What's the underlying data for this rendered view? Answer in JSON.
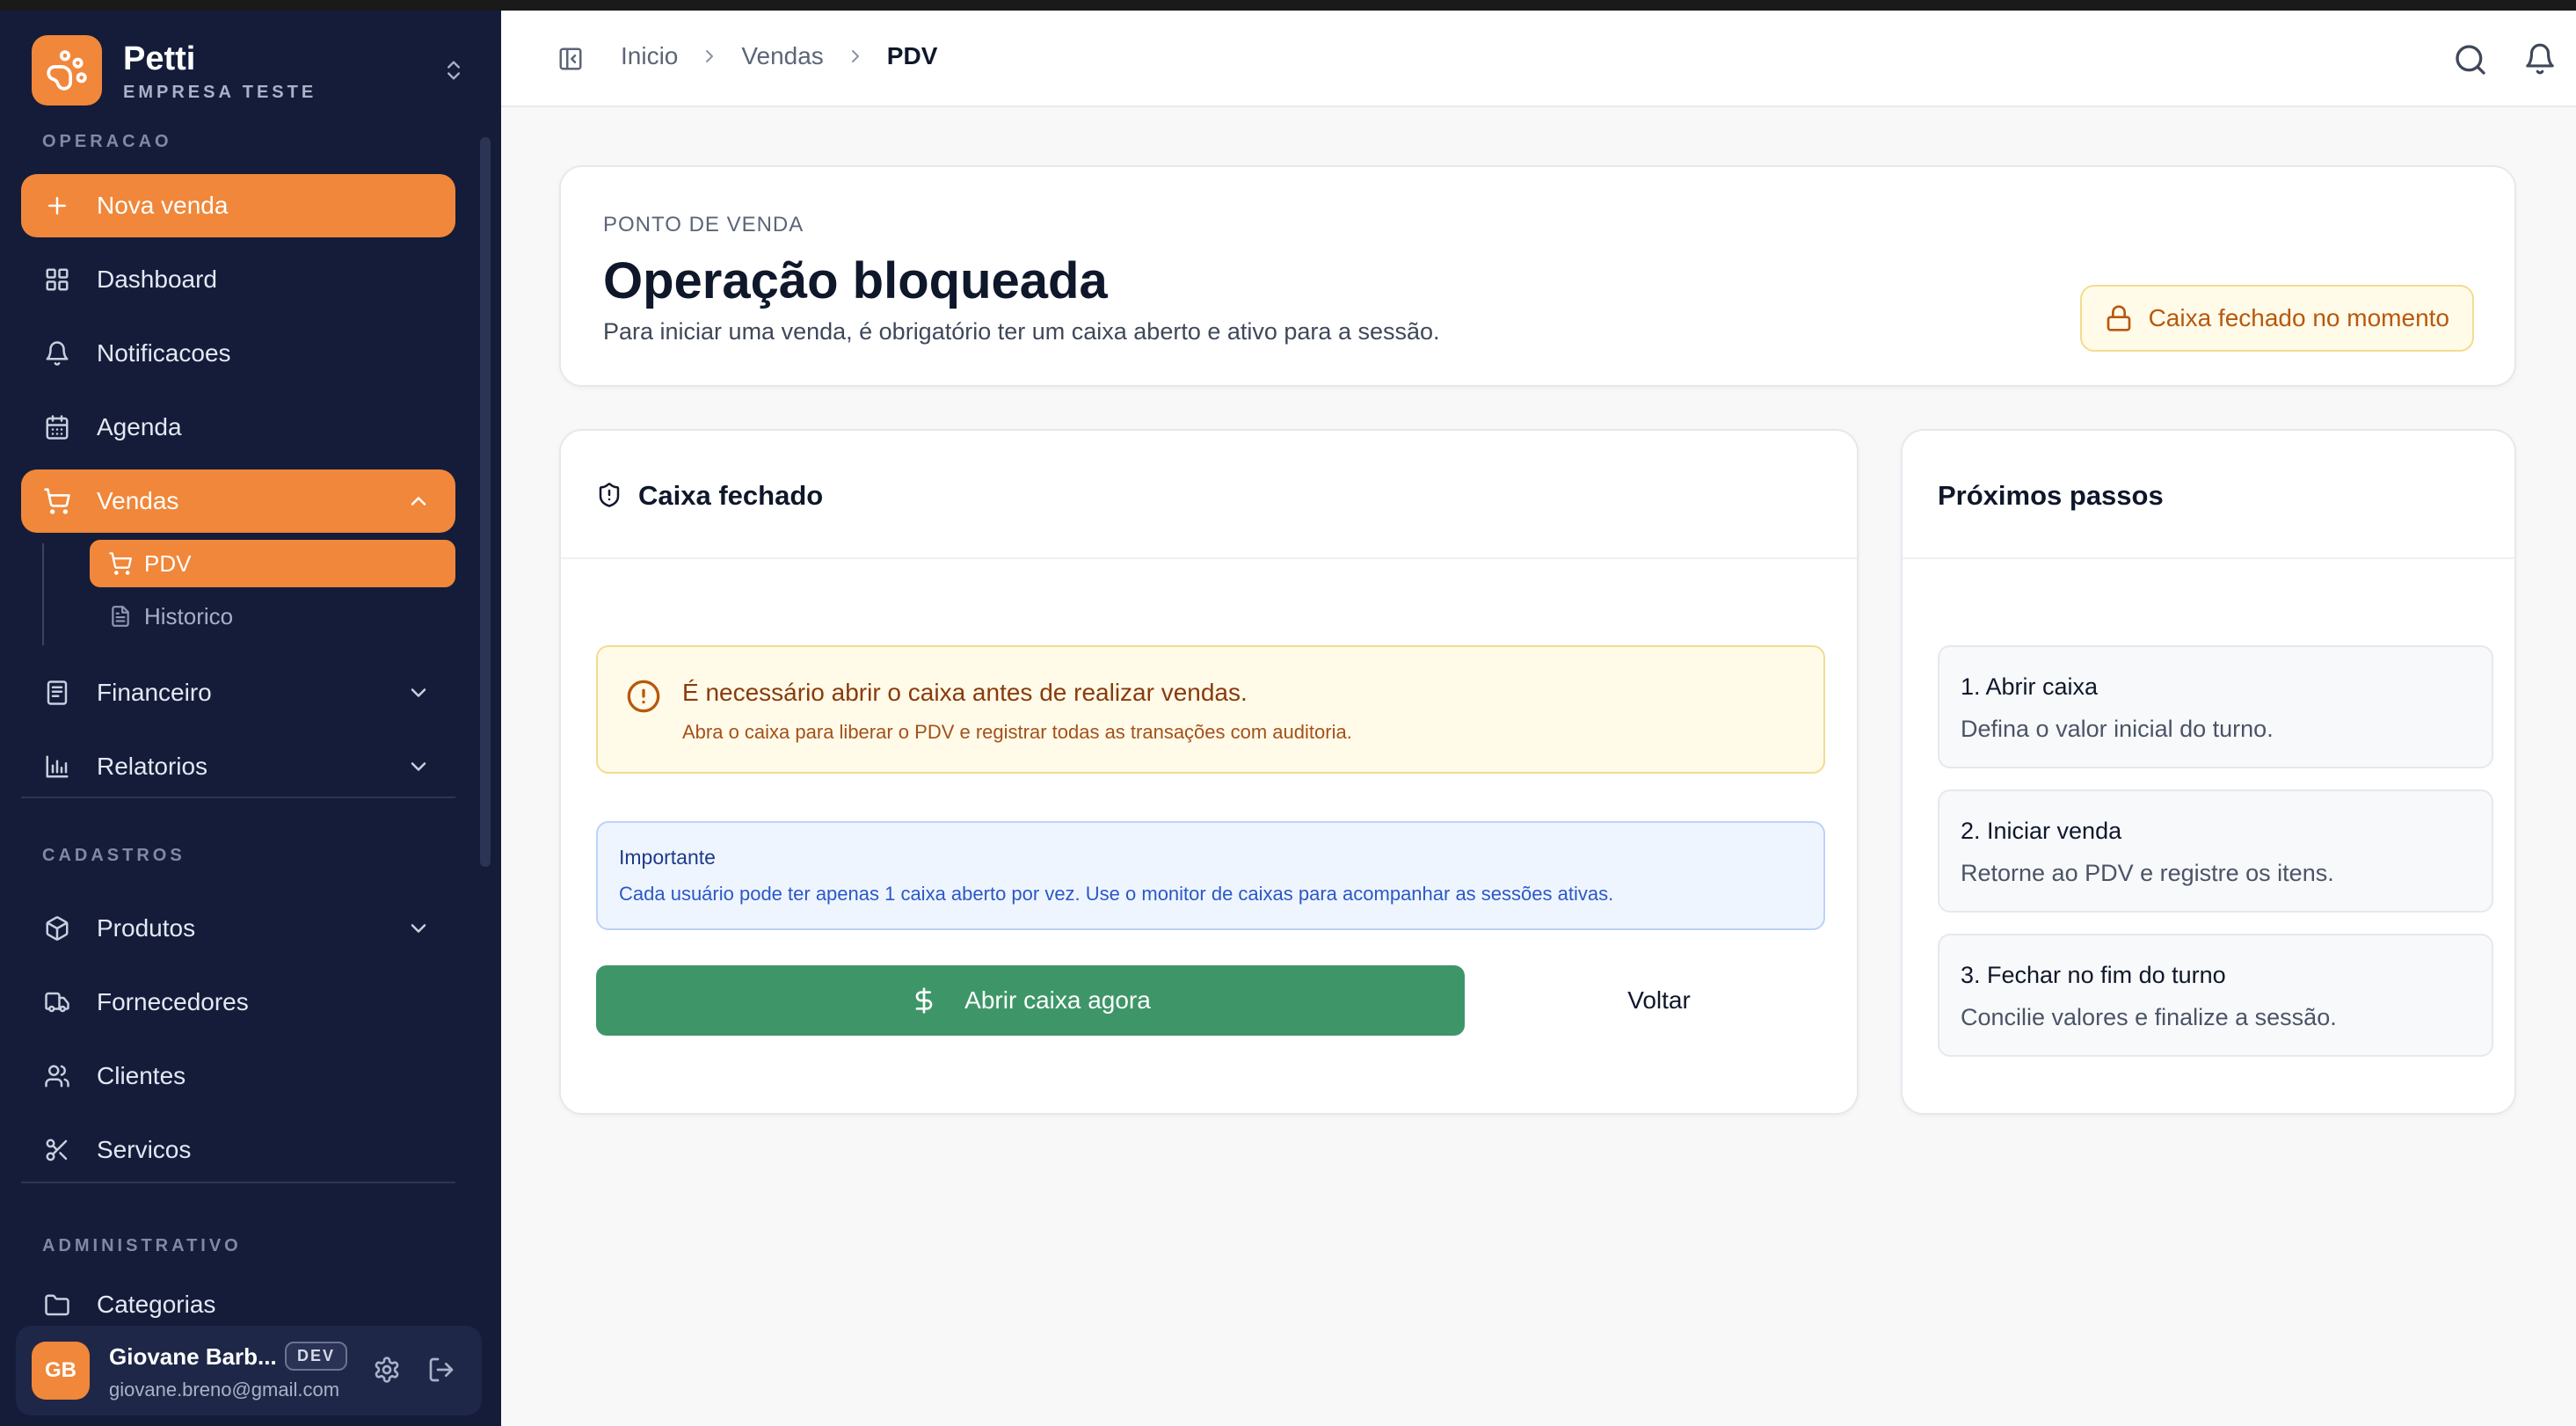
{
  "brand": {
    "name": "Petti",
    "subtitle": "EMPRESA TESTE",
    "accent": "#f0873a"
  },
  "sidebar": {
    "sections": {
      "operacao": "OPERACAO",
      "cadastros": "CADASTROS",
      "administrativo": "ADMINISTRATIVO"
    },
    "items": [
      {
        "label": "Nova venda"
      },
      {
        "label": "Dashboard"
      },
      {
        "label": "Notificacoes"
      },
      {
        "label": "Agenda"
      },
      {
        "label": "Vendas"
      },
      {
        "label": "Financeiro"
      },
      {
        "label": "Relatorios"
      },
      {
        "label": "Produtos"
      },
      {
        "label": "Fornecedores"
      },
      {
        "label": "Clientes"
      },
      {
        "label": "Servicos"
      },
      {
        "label": "Categorias"
      }
    ],
    "sub_items": [
      {
        "label": "PDV"
      },
      {
        "label": "Historico"
      }
    ],
    "colors": {
      "background": "#141c3a",
      "active": "#f0873a"
    }
  },
  "user": {
    "initials": "GB",
    "name": "Giovane Barb...",
    "badge": "DEV",
    "email": "giovane.breno@gmail.com"
  },
  "breadcrumb": {
    "items": [
      "Inicio",
      "Vendas",
      "PDV"
    ]
  },
  "hero": {
    "eyebrow": "PONTO DE VENDA",
    "title": "Operação bloqueada",
    "description": "Para iniciar uma venda, é obrigatório ter um caixa aberto e ativo para a sessão.",
    "status_pill": "Caixa fechado no momento"
  },
  "closed_card": {
    "title": "Caixa fechado",
    "warning": {
      "title": "É necessário abrir o caixa antes de realizar vendas.",
      "text": "Abra o caixa para liberar o PDV e registrar todas as transações com auditoria."
    },
    "info": {
      "title": "Importante",
      "text": "Cada usuário pode ter apenas 1 caixa aberto por vez. Use o monitor de caixas para acompanhar as sessões ativas."
    },
    "primary_button": "Abrir caixa agora",
    "secondary_button": "Voltar",
    "colors": {
      "primary": "#3e9668",
      "warning_bg": "#fffbe8",
      "info_bg": "#eff5ff"
    }
  },
  "steps_card": {
    "title": "Próximos passos",
    "steps": [
      {
        "title": "1. Abrir caixa",
        "text": "Defina o valor inicial do turno."
      },
      {
        "title": "2. Iniciar venda",
        "text": "Retorne ao PDV e registre os itens."
      },
      {
        "title": "3. Fechar no fim do turno",
        "text": "Concilie valores e finalize a sessão."
      }
    ]
  }
}
